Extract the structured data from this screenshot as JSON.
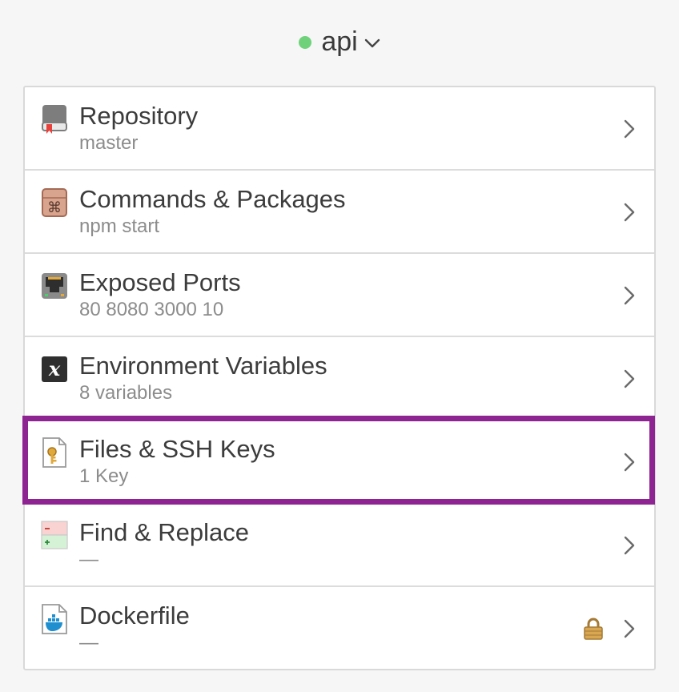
{
  "header": {
    "service_name": "api",
    "status_color": "#6fd27b",
    "status": "running",
    "dropdown_icon": "chevron-down-icon"
  },
  "accent": {
    "highlight_color": "#8e2392"
  },
  "rows": [
    {
      "title": "Repository",
      "subtitle": "master",
      "icon": "repository-book-icon"
    },
    {
      "title": "Commands & Packages",
      "subtitle": "npm start",
      "icon": "command-box-icon"
    },
    {
      "title": "Exposed Ports",
      "subtitle": "80 8080 3000 10",
      "icon": "ethernet-port-icon"
    },
    {
      "title": "Environment Variables",
      "subtitle": "8 variables",
      "icon": "variable-x-icon"
    },
    {
      "title": "Files & SSH Keys",
      "subtitle": "1 Key",
      "icon": "key-file-icon",
      "highlighted": true
    },
    {
      "title": "Find & Replace",
      "subtitle": "—",
      "icon": "diff-icon"
    },
    {
      "title": "Dockerfile",
      "subtitle": "—",
      "icon": "docker-file-icon",
      "locked": true
    }
  ]
}
